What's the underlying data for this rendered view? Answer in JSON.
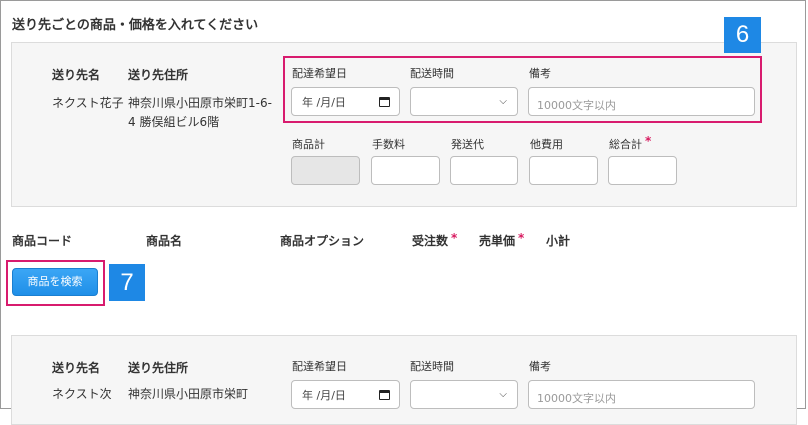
{
  "section_title": "送り先ごとの商品・価格を入れてください",
  "recipients": [
    {
      "name_header": "送り先名",
      "address_header": "送り先住所",
      "name": "ネクスト花子",
      "address": "神奈川県小田原市栄町1-6-4 勝俣組ビル6階",
      "delivery_date_label": "配達希望日",
      "delivery_date_value": "年 /月/日",
      "delivery_time_label": "配送時間",
      "notes_label": "備考",
      "notes_placeholder": "10000文字以内",
      "product_total_label": "商品計",
      "fee_label": "手数料",
      "shipping_label": "発送代",
      "other_label": "他費用",
      "grand_total_label": "総合計",
      "required_mark": "*"
    },
    {
      "name_header": "送り先名",
      "address_header": "送り先住所",
      "name": "ネクスト次",
      "address": "神奈川県小田原市栄町",
      "delivery_date_label": "配達希望日",
      "delivery_date_value": "年 /月/日",
      "delivery_time_label": "配送時間",
      "notes_label": "備考",
      "notes_placeholder": "10000文字以内"
    }
  ],
  "product_table": {
    "columns": [
      "商品コード",
      "商品名",
      "商品オプション",
      "受注数",
      "売単価",
      "小計"
    ],
    "required_mark": "*",
    "search_button": "商品を検索"
  },
  "annotations": {
    "badge_6": "6",
    "badge_7": "7"
  },
  "colors": {
    "highlight": "#d81b6e",
    "badge": "#1e88e5",
    "button": "#1f8fe8",
    "required": "#d81b60"
  }
}
